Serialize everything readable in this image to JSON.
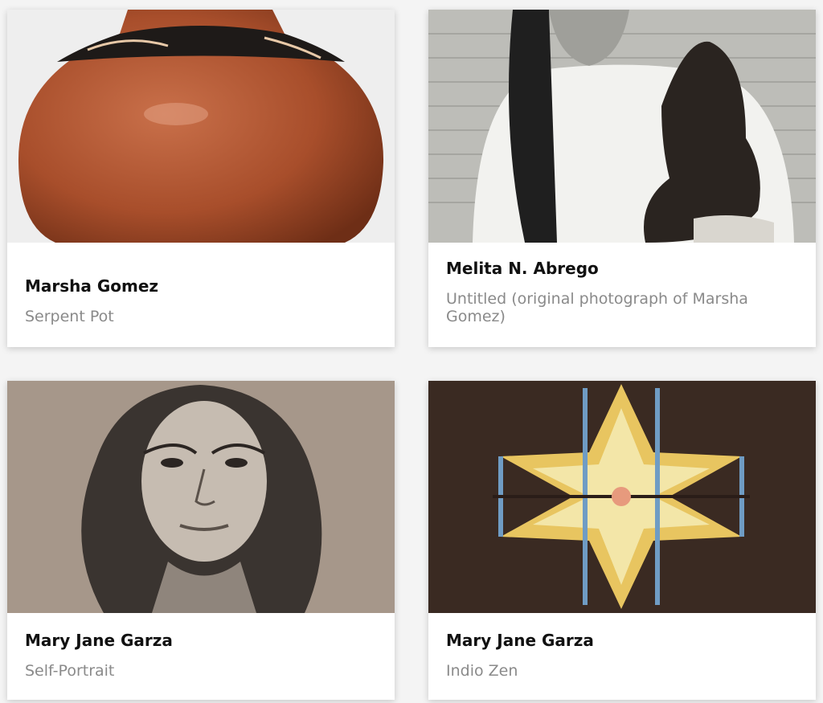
{
  "cards": [
    {
      "artist": "Marsha Gomez",
      "title": "Serpent Pot",
      "image": "serpent-pot-image"
    },
    {
      "artist": "Melita N. Abrego",
      "title": "Untitled (original photograph of Marsha Gomez)",
      "image": "portrait-photo-image"
    },
    {
      "artist": "Mary Jane Garza",
      "title": "Self-Portrait",
      "image": "self-portrait-drawing-image"
    },
    {
      "artist": "Mary Jane Garza",
      "title": "Indio Zen",
      "image": "woven-star-textile-image"
    }
  ]
}
